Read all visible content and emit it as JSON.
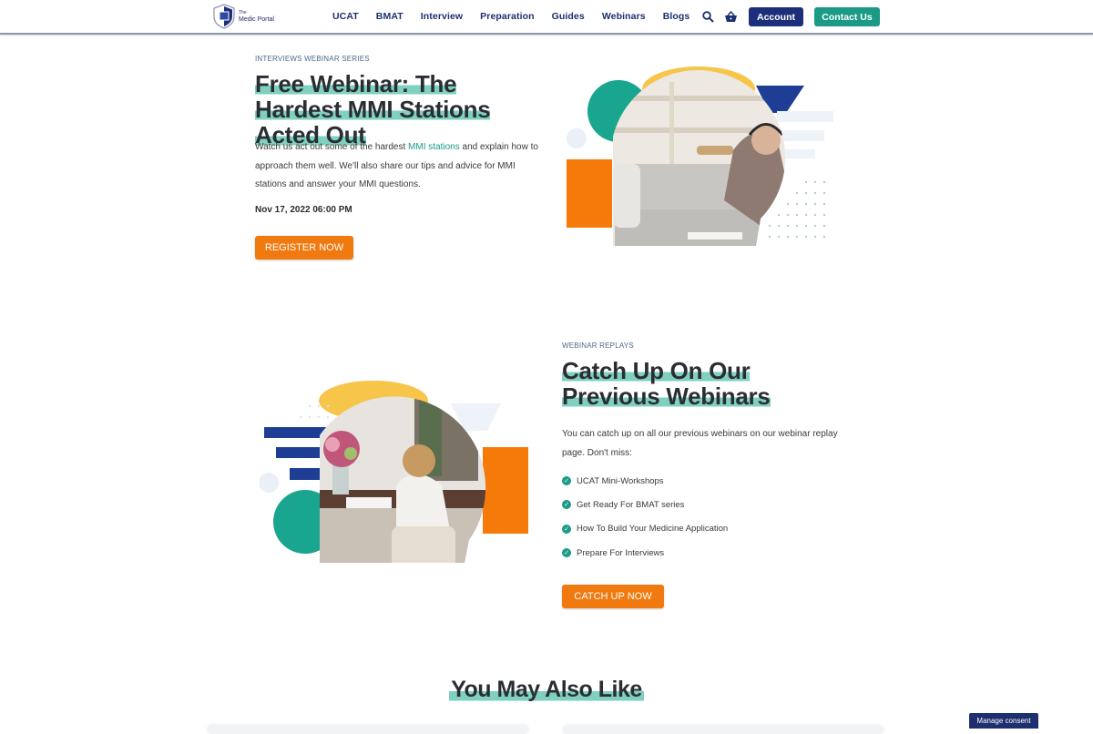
{
  "header": {
    "logo_small": "The",
    "logo_name": "Medic Portal",
    "nav": [
      "UCAT",
      "BMAT",
      "Interview",
      "Preparation",
      "Guides",
      "Webinars",
      "Blogs"
    ],
    "account_label": "Account",
    "contact_label": "Contact Us",
    "icons": [
      "search-icon",
      "basket-icon"
    ]
  },
  "webinar": {
    "eyebrow": "INTERVIEWS WEBINAR SERIES",
    "title": "Free Webinar: The Hardest MMI Stations Acted Out",
    "text_before_link": "Watch us act out some of the hardest ",
    "link_text": "MMI stations",
    "text_after_link": " and explain how to approach them well. We'll also share our tips and advice for MMI stations and answer your MMI questions.",
    "date": "Nov 17, 2022 06:00 PM",
    "button_label": "REGISTER NOW"
  },
  "replays": {
    "eyebrow": "WEBINAR REPLAYS",
    "title": "Catch Up On Our Previous Webinars",
    "text": "You can catch up on all our previous webinars on our webinar replay page. Don't miss:",
    "items": [
      "UCAT Mini-Workshops",
      "Get Ready For BMAT series",
      "How To Build Your Medicine Application",
      "Prepare For Interviews"
    ],
    "button_label": "CATCH UP NOW"
  },
  "also_like": {
    "title": "You May Also Like"
  },
  "consent": {
    "label": "Manage consent"
  },
  "colors": {
    "navy": "#1d2f7a",
    "teal": "#1a9a87",
    "orange": "#f07a10",
    "highlight": "#7fd0c0",
    "yellow": "#f6c54a"
  }
}
